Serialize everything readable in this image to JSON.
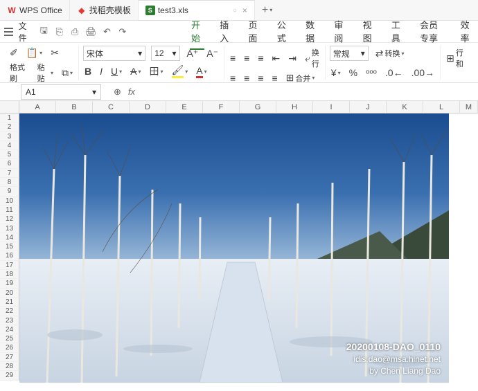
{
  "titlebar": {
    "app_tab": {
      "logo_text": "W",
      "label": "WPS Office"
    },
    "template_tab": {
      "logo_glyph": "◆",
      "label": "找稻壳模板"
    },
    "doc_tab": {
      "logo_text": "S",
      "label": "test3.xls",
      "close": "×"
    },
    "add": "+"
  },
  "menubar": {
    "file_label": "文件",
    "tabs": [
      "开始",
      "插入",
      "页面",
      "公式",
      "数据",
      "审阅",
      "视图",
      "工具",
      "会员专享",
      "效率"
    ],
    "active_index": 0
  },
  "ribbon": {
    "format_painter": "格式刷",
    "paste": "粘贴",
    "font_name": "宋体",
    "font_size": "12",
    "bold": "B",
    "italic": "I",
    "underline": "U",
    "strike": "A",
    "wrap": "换行",
    "merge": "合并",
    "number_format": "常规",
    "convert": "转换",
    "row_col": "行和"
  },
  "formula_bar": {
    "cell_ref": "A1",
    "fx": "fx"
  },
  "grid": {
    "cols": [
      "A",
      "B",
      "C",
      "D",
      "E",
      "F",
      "G",
      "H",
      "I",
      "J",
      "K",
      "L",
      "M"
    ],
    "rows": 29
  },
  "image": {
    "caption_line1": "20200108-DAO_0110",
    "caption_line2": "idis.dao@msa.hinet.net",
    "caption_line3": "by Chen Liang Dao"
  }
}
